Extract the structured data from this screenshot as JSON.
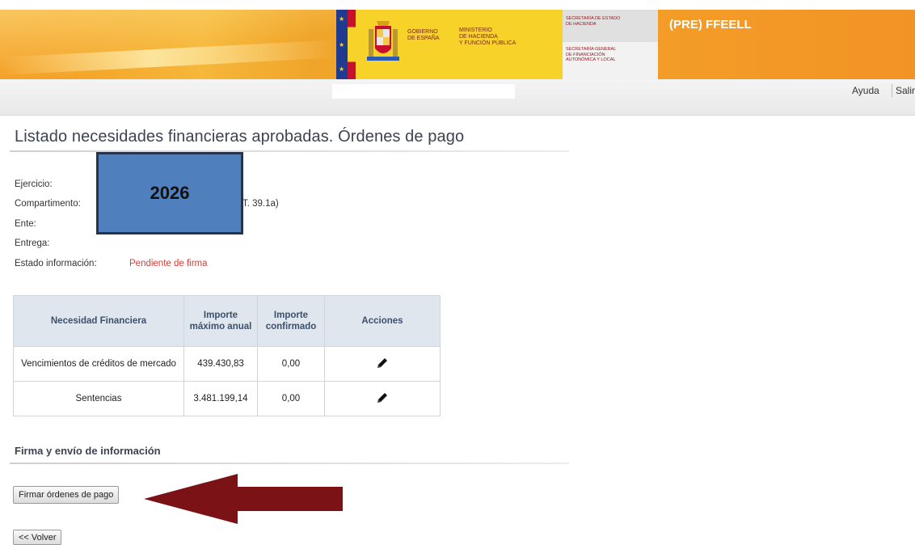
{
  "header": {
    "government_label": [
      "GOBIERNO",
      "DE ESPAÑA"
    ],
    "ministry_label": [
      "MINISTERIO",
      "DE HACIENDA",
      "Y FUNCIÓN PÚBLICA"
    ],
    "secretariat_top": [
      "SECRETARÍA DE ESTADO",
      "DE HACIENDA"
    ],
    "secretariat_bottom": [
      "SECRETARÍA GENERAL",
      "DE FINANCIACIÓN",
      "AUTONÓMICA Y LOCAL"
    ],
    "app_title": "(PRE) FFEELL"
  },
  "toolbar": {
    "help_label": "Ayuda",
    "exit_label": "Salir"
  },
  "page": {
    "title": "Listado necesidades financieras aprobadas. Órdenes de pago"
  },
  "info": {
    "fields": [
      {
        "label": "Ejercicio:",
        "value": ""
      },
      {
        "label": "Compartimento:",
        "value": "T. 39.1a)"
      },
      {
        "label": "Ente:",
        "value": ""
      },
      {
        "label": "Entrega:",
        "value": ""
      },
      {
        "label": "Estado información:",
        "value": "Pendiente de firma"
      }
    ],
    "year_overlay": "2026"
  },
  "table": {
    "headers": [
      "Necesidad Financiera",
      "Importe máximo anual",
      "Importe confirmado",
      "Acciones"
    ],
    "rows": [
      {
        "need": "Vencimientos de créditos de mercado",
        "max_annual": "439.430,83",
        "confirmed": "0,00",
        "action_icon": "pencil-edit-icon"
      },
      {
        "need": "Sentencias",
        "max_annual": "3.481.199,14",
        "confirmed": "0,00",
        "action_icon": "pencil-edit-icon"
      }
    ]
  },
  "signing": {
    "section_title": "Firma y envío de información",
    "sign_button": "Firmar órdenes de pago",
    "back_button": "<< Volver"
  },
  "colors": {
    "banner_orange": "#f39a1e",
    "status_red": "#e8342f",
    "table_header_bg": "#dfe6ee",
    "overlay_blue": "#4f80bd",
    "arrow_dark_red": "#7b1216"
  }
}
